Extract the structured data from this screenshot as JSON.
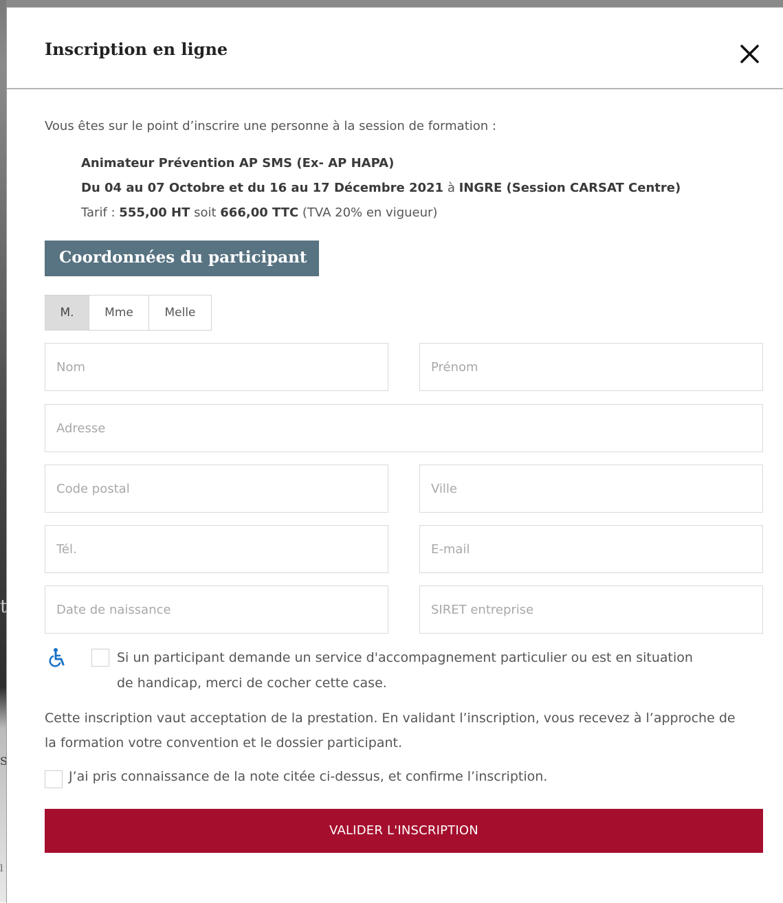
{
  "modal": {
    "title": "Inscription en ligne",
    "intro": "Vous êtes sur le point d’inscrire une personne à la session de formation :",
    "session": {
      "name": "Animateur Prévention AP SMS (Ex- AP HAPA)",
      "dates": "Du 04 au 07 Octobre et du 16 au 17 Décembre 2021",
      "at": " à ",
      "location": "INGRE (Session CARSAT Centre)",
      "tarif_label": "Tarif : ",
      "price_ht": "555,00 HT",
      "soit": " soit ",
      "price_ttc": "666,00 TTC",
      "tva_note": " (TVA 20% en vigueur)"
    },
    "section_title": "Coordonnées du participant",
    "civility": {
      "options": [
        "M.",
        "Mme",
        "Melle"
      ],
      "selected": "M."
    },
    "fields": {
      "nom": "Nom",
      "prenom": "Prénom",
      "adresse": "Adresse",
      "code_postal": "Code postal",
      "ville": "Ville",
      "tel": "Tél.",
      "email": "E-mail",
      "date_naissance": "Date de naissance",
      "siret": "SIRET entreprise"
    },
    "handicap": {
      "icon": "wheelchair-icon",
      "text": "Si un participant demande un service d'accompagnement particulier ou est en situation de handicap, merci de cocher cette case.",
      "checked": false
    },
    "note": "Cette inscription vaut acceptation de la prestation. En validant l’inscription, vous recevez à l’approche de la formation votre convention et le dossier participant.",
    "confirm": {
      "text": "J’ai pris connaissance de la note citée ci-dessus, et confirme l’inscription.",
      "checked": false
    },
    "submit_label": "VALIDER L'INSCRIPTION",
    "colors": {
      "section_bg": "#587382",
      "submit_bg": "#a50e2d",
      "accent_icon": "#1a73c8"
    }
  }
}
